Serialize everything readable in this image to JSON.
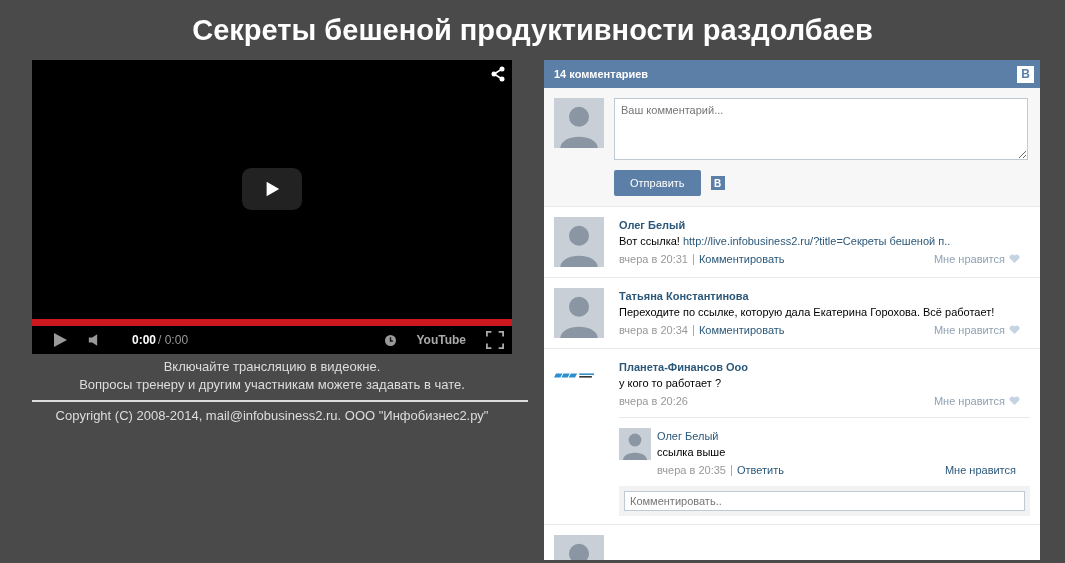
{
  "page_title": "Секреты бешеной продуктивности раздолбаев",
  "video": {
    "progress": {
      "level": 1
    },
    "time_current": "0:00",
    "time_total": "/ 0:00",
    "brand": "YouTube"
  },
  "notes": [
    "Включайте трансляцию в видеокне.",
    "Вопросы тренеру и другим участникам можете задавать в чате."
  ],
  "copyright": "Copyright (C) 2008-2014, mail@infobusiness2.ru. ООО \"Инфобизнес2.ру\"",
  "comments_widget": {
    "title": "14 комментариев",
    "badge": "В",
    "input": {
      "placeholder": "Ваш комментарий..."
    },
    "send_button": "Отправить",
    "send_badge": "В",
    "comments": [
      {
        "author": "Олег Белый",
        "text": "Вот ссылка!",
        "link": "http://live.infobusiness2.ru/?title=Секреты бешеной п..",
        "time": "вчера в 20:31",
        "action": "Комментировать",
        "like": "Мне нравится",
        "heart": true,
        "kind": "person"
      },
      {
        "author": "Татьяна Константинова",
        "text": "Переходите по ссылке, которую дала Екатерина Горохова. Всё работает!",
        "time": "вчера в 20:34",
        "action": "Комментировать",
        "like": "Мне нравится",
        "heart": true,
        "kind": "person"
      },
      {
        "author": "Планета-Финансов Ооо",
        "text": "у кого то работает ?",
        "time": "вчера в 20:26",
        "like": "Мне нравится",
        "heart": true,
        "kind": "logo",
        "children": [
          {
            "author": "Олег Белый",
            "text": "ссылка выше",
            "time": "вчера в 20:35",
            "action": "Ответить",
            "like": "Мне нравится",
            "heart": false,
            "kind": "person"
          }
        ],
        "reply_input": {
          "placeholder": "Комментировать.."
        }
      },
      {
        "kind": "person"
      }
    ]
  }
}
